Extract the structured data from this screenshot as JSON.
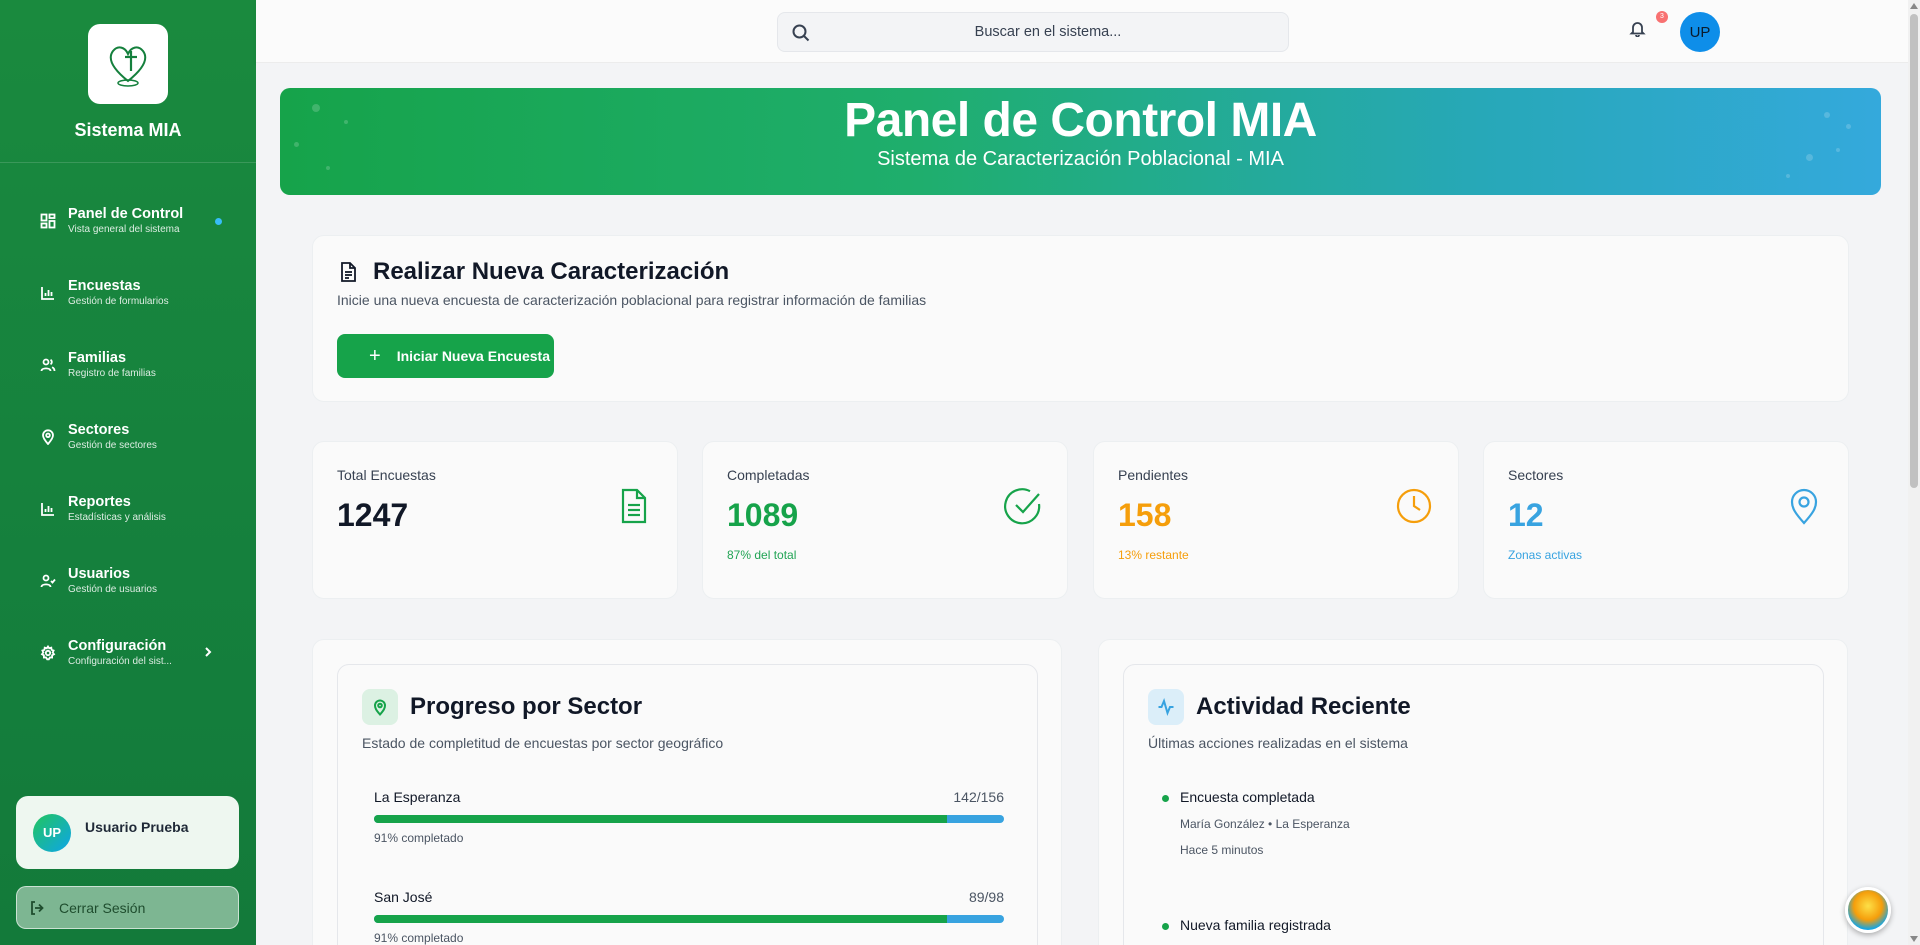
{
  "app": {
    "name": "Sistema MIA"
  },
  "sidebar": {
    "items": [
      {
        "label": "Panel de Control",
        "sub": "Vista general del sistema",
        "icon": "dashboard-icon"
      },
      {
        "label": "Encuestas",
        "sub": "Gestión de formularios",
        "icon": "bar-chart-icon"
      },
      {
        "label": "Familias",
        "sub": "Registro de familias",
        "icon": "users-icon"
      },
      {
        "label": "Sectores",
        "sub": "Gestión de sectores",
        "icon": "map-pin-icon"
      },
      {
        "label": "Reportes",
        "sub": "Estadísticas y análisis",
        "icon": "bar-chart-icon"
      },
      {
        "label": "Usuarios",
        "sub": "Gestión de usuarios",
        "icon": "user-check-icon"
      },
      {
        "label": "Configuración",
        "sub": "Configuración del sist...",
        "icon": "gear-icon"
      }
    ],
    "user": {
      "initials": "UP",
      "name": "Usuario Prueba"
    },
    "logout_label": "Cerrar Sesión"
  },
  "topbar": {
    "search_placeholder": "Buscar en el sistema...",
    "notifications": "3",
    "avatar_initials": "UP"
  },
  "hero": {
    "title": "Panel de Control MIA",
    "subtitle": "Sistema de Caracterización Poblacional - MIA"
  },
  "new_survey": {
    "title": "Realizar Nueva Caracterización",
    "description": "Inicie una nueva encuesta de caracterización poblacional para registrar información de familias",
    "button_label": "Iniciar Nueva Encuesta"
  },
  "stats": [
    {
      "label": "Total Encuestas",
      "value": "1247",
      "note": "",
      "color": "#111827",
      "icon_color": "#16a34a",
      "icon": "document-icon"
    },
    {
      "label": "Completadas",
      "value": "1089",
      "note": "87% del total",
      "color": "#16a34a",
      "icon_color": "#16a34a",
      "icon": "check-circle-icon"
    },
    {
      "label": "Pendientes",
      "value": "158",
      "note": "13% restante",
      "color": "#f59e0b",
      "icon_color": "#f59e0b",
      "icon": "clock-icon"
    },
    {
      "label": "Sectores",
      "value": "12",
      "note": "Zonas activas",
      "color": "#38a3e0",
      "icon_color": "#38a3e0",
      "icon": "map-pin-icon"
    }
  ],
  "progress": {
    "title": "Progreso por Sector",
    "description": "Estado de completitud de encuestas por sector geográfico",
    "sectors": [
      {
        "name": "La Esperanza",
        "count": "142/156",
        "percent_label": "91% completado",
        "percent": 91
      },
      {
        "name": "San José",
        "count": "89/98",
        "percent_label": "91% completado",
        "percent": 91
      }
    ]
  },
  "activity": {
    "title": "Actividad Reciente",
    "description": "Últimas acciones realizadas en el sistema",
    "items": [
      {
        "title": "Encuesta completada",
        "meta": "María González • La Esperanza",
        "time": "Hace 5 minutos"
      },
      {
        "title": "Nueva familia registrada",
        "meta": "",
        "time": ""
      }
    ]
  },
  "colors": {
    "brand_green": "#16a34a",
    "accent_blue": "#38a3e0",
    "warning": "#f59e0b"
  }
}
